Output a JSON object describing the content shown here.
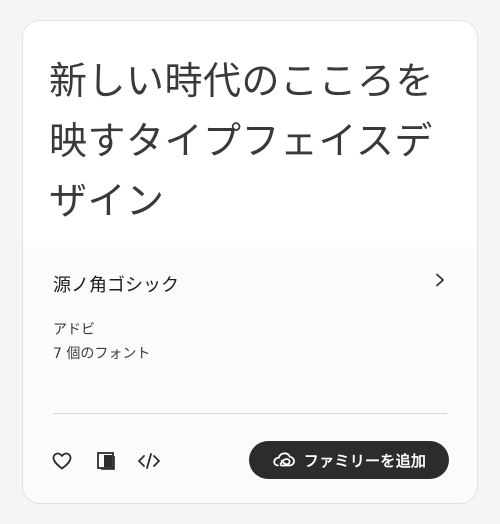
{
  "card": {
    "preview_text": "新しい時代のこころを映すタイプフェイスデザイン",
    "family_name": "源ノ角ゴシック",
    "foundry": "アドビ",
    "font_count": "7 個のフォント",
    "add_button_label": "ファミリーを追加",
    "icons": {
      "chevron": "chevron-right-icon",
      "favorite": "heart-icon",
      "compare": "compare-icon",
      "embed": "code-icon",
      "creative_cloud": "creative-cloud-icon"
    },
    "colors": {
      "button_background": "#2c2c2c",
      "button_text": "#ffffff",
      "preview_text": "#3a3a3a"
    }
  }
}
